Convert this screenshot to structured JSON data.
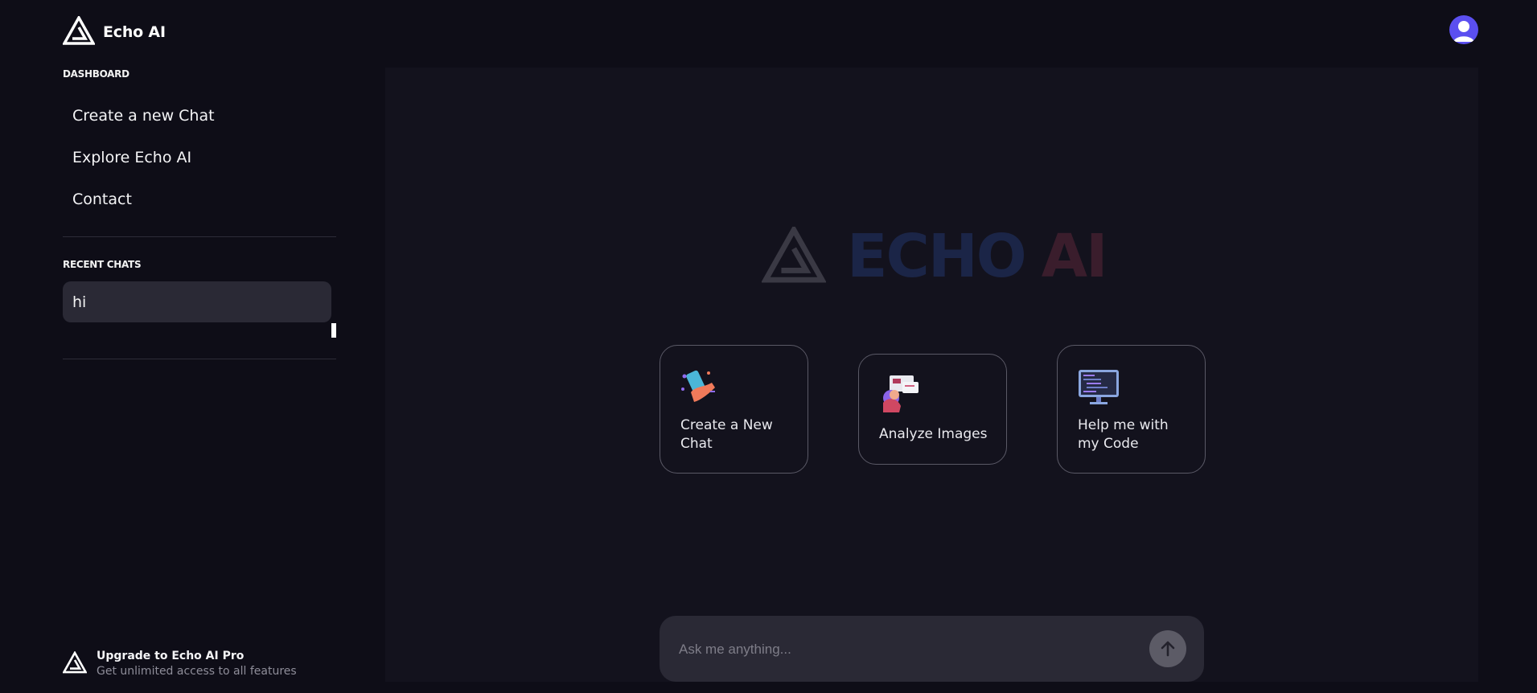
{
  "app": {
    "title": "Echo AI"
  },
  "sidebar": {
    "dashboard_label": "DASHBOARD",
    "nav": [
      {
        "label": "Create a new Chat"
      },
      {
        "label": "Explore Echo AI"
      },
      {
        "label": "Contact"
      }
    ],
    "recent_label": "RECENT CHATS",
    "recent_chats": [
      {
        "label": "hi"
      }
    ],
    "upgrade": {
      "title": "Upgrade to Echo AI Pro",
      "subtitle": "Get unlimited access to all features"
    }
  },
  "main": {
    "hero": {
      "word1": "ECHO",
      "word2": "AI"
    },
    "cards": [
      {
        "label": "Create a New Chat",
        "icon": "chat-illustration-icon"
      },
      {
        "label": "Analyze Images",
        "icon": "image-analysis-illustration-icon"
      },
      {
        "label": "Help me with my Code",
        "icon": "code-monitor-illustration-icon"
      }
    ],
    "prompt": {
      "placeholder": "Ask me anything...",
      "value": ""
    }
  },
  "colors": {
    "background": "#0e0d17",
    "panel": "#13121d",
    "surface": "#2a2935",
    "avatar": "#5b4ff0",
    "hero_echo": "#1b2547",
    "hero_ai": "#3a1d2c"
  }
}
